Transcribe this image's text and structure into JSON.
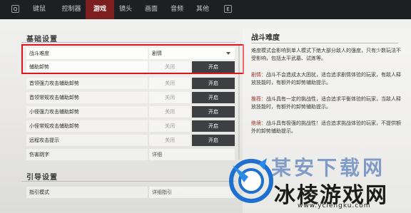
{
  "topbar": {
    "left_key": "Q",
    "right_key": "E",
    "tabs": [
      {
        "label": "键鼠"
      },
      {
        "label": "控制器"
      },
      {
        "label": "游戏",
        "active": true
      },
      {
        "label": "镜头"
      },
      {
        "label": "画面"
      },
      {
        "label": "音频"
      },
      {
        "label": "其他"
      }
    ]
  },
  "sections": {
    "basic_title": "基础设置",
    "guide_title": "引导设置"
  },
  "rows": [
    {
      "label": "战斗难度",
      "type": "dropdown",
      "value": "剧情"
    },
    {
      "label": "辅助卸势",
      "type": "toggle",
      "off": "关闭",
      "on": "开启"
    },
    {
      "label": "首领强力攻击辅助卸势",
      "type": "toggle",
      "off": "关闭",
      "on": "开启"
    },
    {
      "label": "首领常规攻击辅助卸势",
      "type": "toggle",
      "off": "关闭",
      "on": "开启"
    },
    {
      "label": "小怪强力攻击辅助卸势",
      "type": "toggle",
      "off": "关闭",
      "on": "开启"
    },
    {
      "label": "小怪常规攻击辅助卸势",
      "type": "toggle",
      "off": "关闭",
      "on": "开启"
    },
    {
      "label": "远程攻击提示",
      "type": "toggle",
      "off": "关闭",
      "on": "开启"
    },
    {
      "label": "伤害跳字",
      "type": "detail",
      "value": "详细"
    }
  ],
  "guide_rows": [
    {
      "label": "指引模式",
      "type": "detail",
      "value": "详细指引"
    }
  ],
  "panel": {
    "title": "战斗难度",
    "intro": "难度模式会影响到单人模式下绝大部分敌人的强度，只有少数玩法不受影响，包括太平武墓、试炼等。",
    "modes": [
      {
        "name": "剧情：",
        "text": "战斗不会造成太大困扰，适合追求剧情体验的玩家，有敌人释放技能时，有额外的卸势辅助提示。"
      },
      {
        "name": "推荐：",
        "text": "战斗具有一定的挑战性，适合追求平衡体验的玩家，当敌人释放技能时，有额外的卸势辅助提示。"
      },
      {
        "name": "绝境：",
        "text": "战斗具有极强的挑战性！适合追求挑战体验的玩家，不提供额外的卸势辅助提示。"
      }
    ]
  },
  "watermark": {
    "top_text": "某安下载网",
    "main_text": "冰棱游戏网",
    "url": "www.yclengku.com"
  },
  "colors": {
    "topbar": "#1e1f22",
    "active_tab": "#7d1f1f",
    "highlight_border": "#e0141d",
    "toggle_on": "#3d3f42",
    "mode_name": "#a4322a"
  }
}
